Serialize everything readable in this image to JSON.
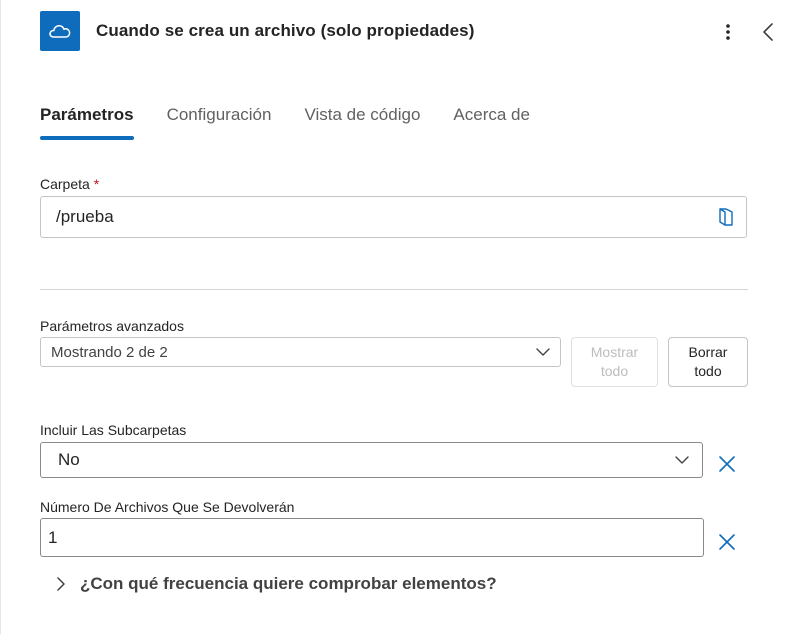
{
  "header": {
    "title": "Cuando se crea un archivo (solo propiedades)",
    "app_icon": "onedrive-cloud-icon",
    "accent_color": "#0f6cbd"
  },
  "tabs": [
    {
      "label": "Parámetros",
      "active": true
    },
    {
      "label": "Configuración",
      "active": false
    },
    {
      "label": "Vista de código",
      "active": false
    },
    {
      "label": "Acerca de",
      "active": false
    }
  ],
  "folder": {
    "label": "Carpeta",
    "required_mark": "*",
    "value": "/prueba",
    "picker_icon": "folder-picker-icon"
  },
  "advanced": {
    "label": "Parámetros avanzados",
    "selected": "Mostrando 2 de 2",
    "show_all_label": "Mostrar todo",
    "show_all_line1": "Mostrar",
    "show_all_line2": "todo",
    "clear_all_line1": "Borrar",
    "clear_all_line2": "todo"
  },
  "include_subfolders": {
    "label": "Incluir Las Subcarpetas",
    "value": "No"
  },
  "file_count": {
    "label": "Número De Archivos Que Se Devolverán",
    "value": "1"
  },
  "frequency_section": {
    "label": "¿Con qué frecuencia quiere comprobar elementos?"
  }
}
